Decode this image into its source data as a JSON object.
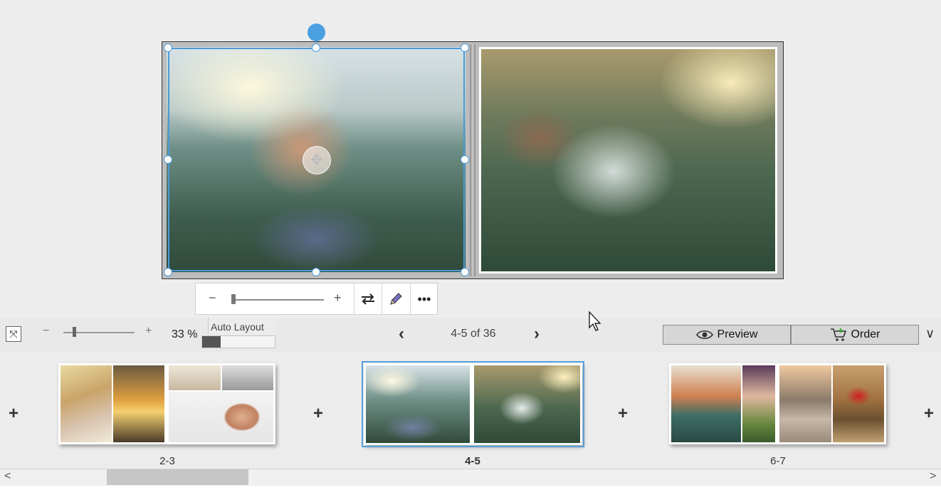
{
  "photo_toolbar": {
    "minus": "−",
    "plus": "+",
    "swap_icon": "swap-arrows-icon",
    "edit_icon": "pencil-icon",
    "more_icon": "more-dots-icon"
  },
  "zoom": {
    "minus": "−",
    "plus": "+",
    "value": "33 %"
  },
  "auto_layout": {
    "label": "Auto Layout",
    "progress": 0.25
  },
  "navigation": {
    "prev": "‹",
    "next": "›",
    "page_counter": "4-5 of 36"
  },
  "actions": {
    "preview_label": "Preview",
    "order_label": "Order",
    "dropdown": "∨"
  },
  "thumbnails": [
    {
      "label": "2-3",
      "selected": false
    },
    {
      "label": "4-5",
      "selected": true
    },
    {
      "label": "6-7",
      "selected": false
    }
  ],
  "add_symbol": "+",
  "scrollbar": {
    "left": "<",
    "right": ">"
  },
  "colors": {
    "selection": "#4a9ad8",
    "accent": "#5aa0dc"
  }
}
